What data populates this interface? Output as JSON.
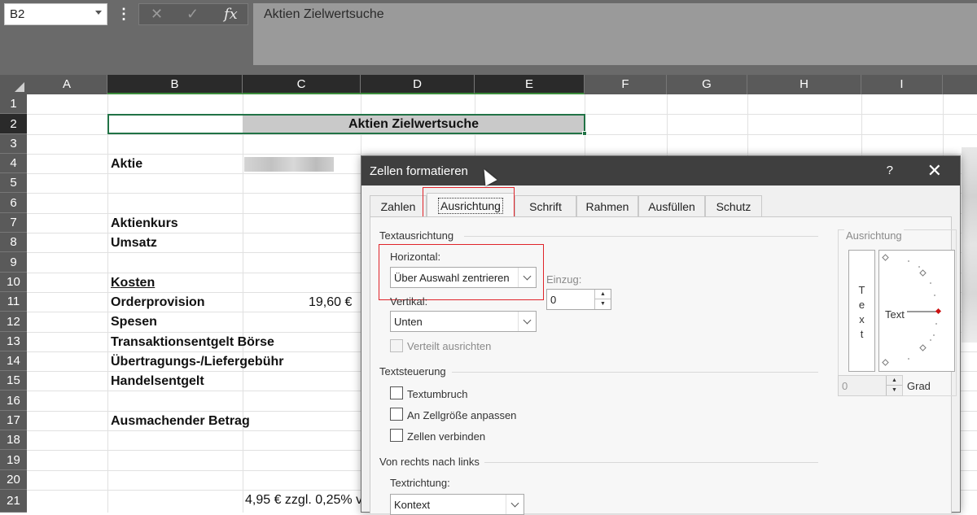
{
  "formula_bar": {
    "name_box": "B2",
    "menu_dots": "⋮",
    "cancel_icon": "✕",
    "enter_icon": "✓",
    "fx_icon": "fx",
    "content": "Aktien Zielwertsuche"
  },
  "columns": [
    "A",
    "B",
    "C",
    "D",
    "E",
    "F",
    "G",
    "H",
    "I"
  ],
  "rows": [
    "1",
    "2",
    "3",
    "4",
    "5",
    "6",
    "7",
    "8",
    "9",
    "10",
    "11",
    "12",
    "13",
    "14",
    "15",
    "16",
    "17",
    "18",
    "19",
    "20",
    "21"
  ],
  "sheet": {
    "title": "Aktien Zielwertsuche",
    "aktie": "Aktie",
    "aktienkurs": "Aktienkurs",
    "umsatz": "Umsatz",
    "kosten": "Kosten",
    "orderprovision": "Orderprovision",
    "orderprovision_value": "19,60 €",
    "spesen": "Spesen",
    "transaktionsentgelt": "Transaktionsentgelt Börse",
    "uebertragung": "Übertragungs-/Liefergebühr",
    "handelsentgelt": "Handelsentgelt",
    "ausmachender_betrag": "Ausmachender Betrag",
    "row21_note": "4,95 € zzgl. 0,25% v"
  },
  "dialog": {
    "title": "Zellen formatieren",
    "help": "?",
    "close": "✕",
    "tabs": [
      "Zahlen",
      "Ausrichtung",
      "Schrift",
      "Rahmen",
      "Ausfüllen",
      "Schutz"
    ],
    "active_tab": "Ausrichtung",
    "textausrichtung": {
      "heading": "Textausrichtung",
      "horizontal_label": "Horizontal:",
      "horizontal_value": "Über Auswahl zentrieren",
      "einzug_label": "Einzug:",
      "einzug_value": "0",
      "vertikal_label": "Vertikal:",
      "vertikal_value": "Unten",
      "verteilt_label": "Verteilt ausrichten"
    },
    "textsteuerung": {
      "heading": "Textsteuerung",
      "textumbruch": "Textumbruch",
      "zellgroesse": "An Zellgröße anpassen",
      "zellen_verbinden": "Zellen verbinden"
    },
    "rtl": {
      "heading": "Von rechts nach links",
      "textrichtung_label": "Textrichtung:",
      "textrichtung_value": "Kontext"
    },
    "ausrichtung": {
      "heading": "Ausrichtung",
      "vertical_text_letters": [
        "T",
        "e",
        "x",
        "t"
      ],
      "dial_text": "Text",
      "grad_value": "0",
      "grad_label": "Grad"
    }
  },
  "colors": {
    "accent_green": "#217346",
    "highlight_red": "#e0242a",
    "dialog_title_bg": "#3f3f3f"
  }
}
